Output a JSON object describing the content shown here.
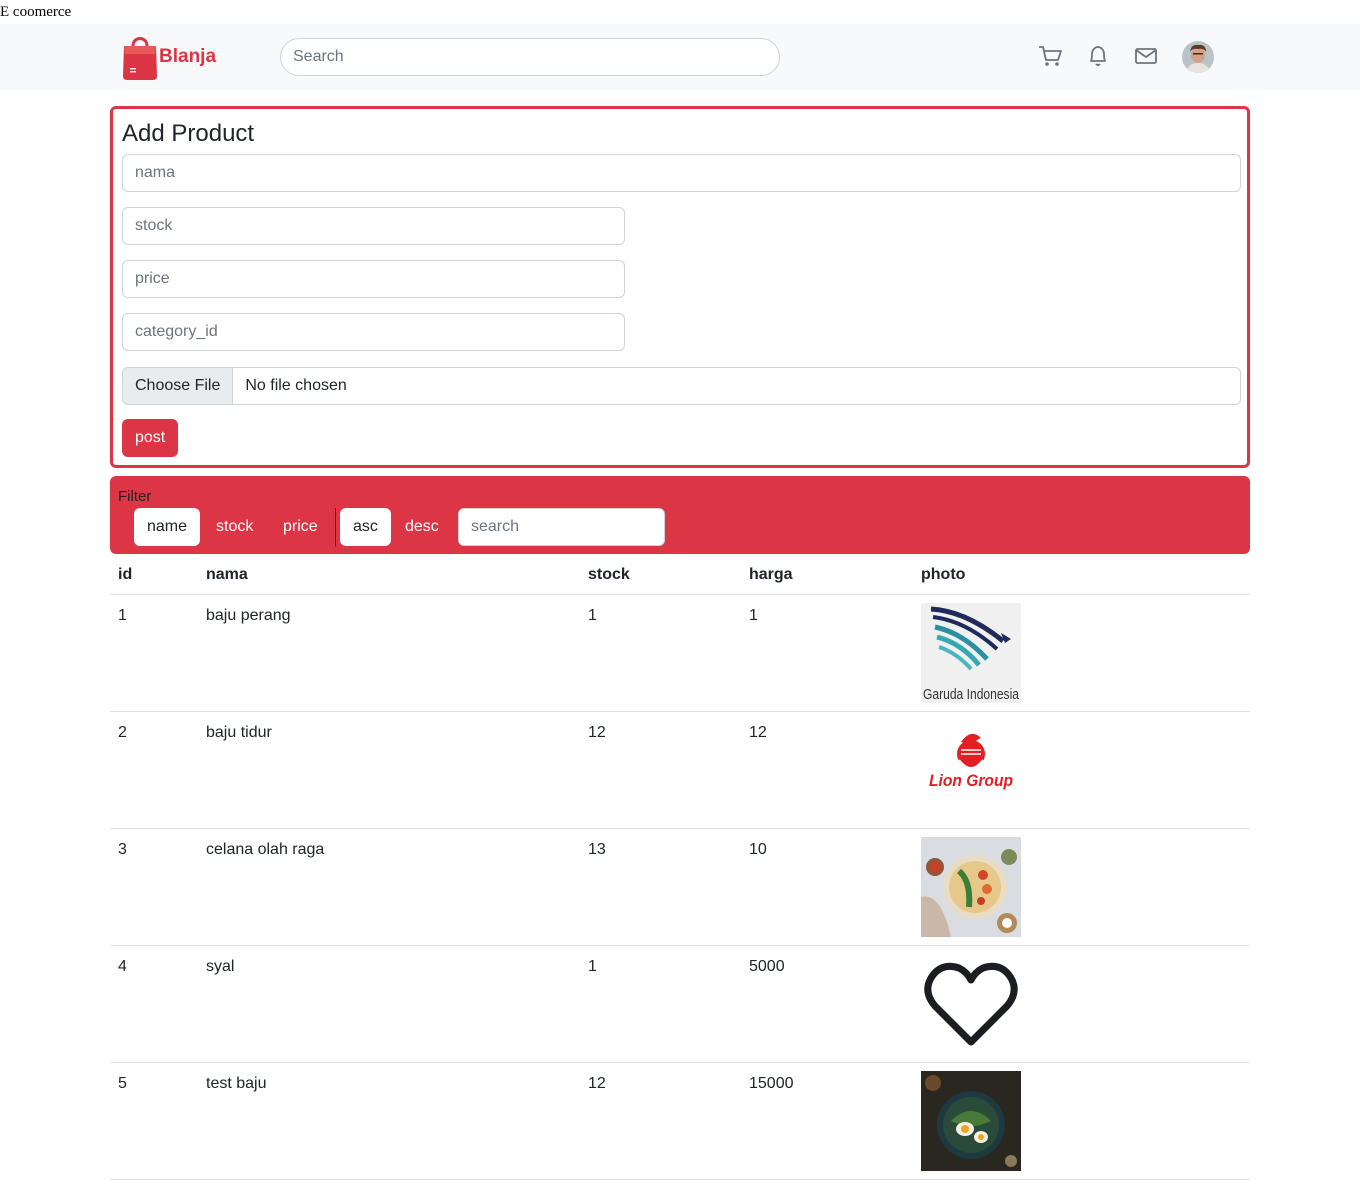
{
  "page": {
    "caption": "E coomerce"
  },
  "navbar": {
    "brand": "Blanja",
    "search_placeholder": "Search",
    "icons": [
      "cart-icon",
      "bell-icon",
      "mail-icon"
    ],
    "accent": "#db3545"
  },
  "add_product": {
    "title": "Add Product",
    "fields": {
      "nama": "nama",
      "stock": "stock",
      "price": "price",
      "category_id": "category_id"
    },
    "file": {
      "button": "Choose File",
      "status": "No file chosen"
    },
    "submit": "post"
  },
  "filter": {
    "label": "Filter",
    "sort_fields": [
      "name",
      "stock",
      "price"
    ],
    "active_sort_field": "name",
    "orders": [
      "asc",
      "desc"
    ],
    "active_order": "asc",
    "search_placeholder": "search",
    "color": "#dc3545"
  },
  "table": {
    "headers": [
      "id",
      "nama",
      "stock",
      "harga",
      "photo"
    ],
    "rows": [
      {
        "id": "1",
        "nama": "baju perang",
        "stock": "1",
        "harga": "1",
        "photo": "Garuda Indonesia"
      },
      {
        "id": "2",
        "nama": "baju tidur",
        "stock": "12",
        "harga": "12",
        "photo": "Lion Group"
      },
      {
        "id": "3",
        "nama": "celana olah raga",
        "stock": "13",
        "harga": "10",
        "photo": "food-bowl-image"
      },
      {
        "id": "4",
        "nama": "syal",
        "stock": "1",
        "harga": "5000",
        "photo": "heart-outline-image"
      },
      {
        "id": "5",
        "nama": "test baju",
        "stock": "12",
        "harga": "15000",
        "photo": "food-plate-image"
      }
    ]
  }
}
